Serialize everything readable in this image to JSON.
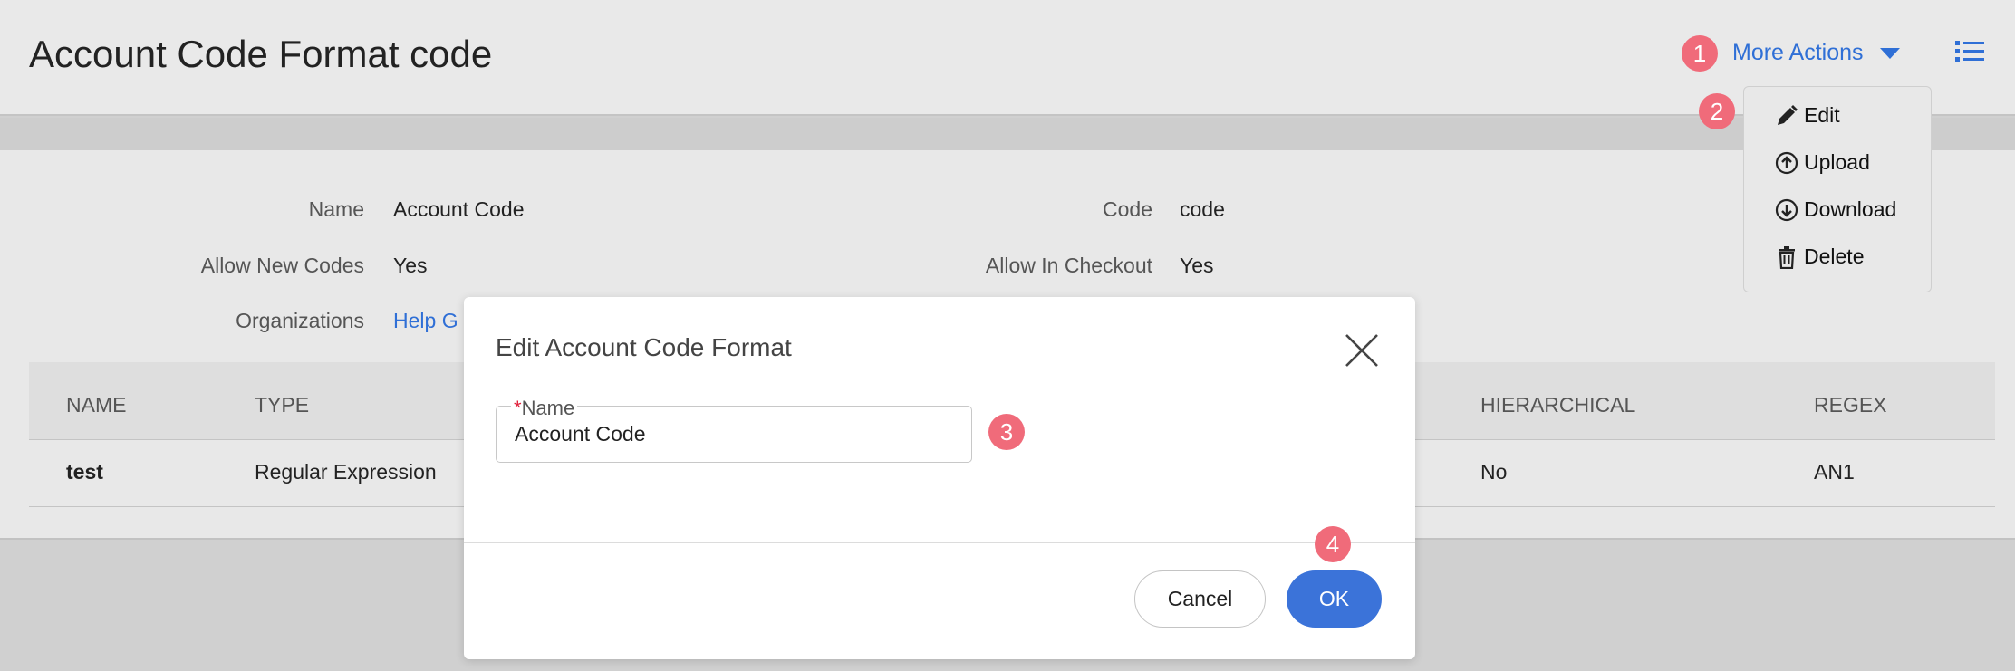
{
  "header": {
    "title": "Account Code Format code",
    "more_actions_label": "More Actions"
  },
  "menu": {
    "items": [
      {
        "label": "Edit",
        "icon": "pencil-icon"
      },
      {
        "label": "Upload",
        "icon": "upload-circle-icon"
      },
      {
        "label": "Download",
        "icon": "download-circle-icon"
      },
      {
        "label": "Delete",
        "icon": "trash-icon"
      }
    ]
  },
  "details": {
    "name_label": "Name",
    "name_value": "Account Code",
    "allow_new_label": "Allow New Codes",
    "allow_new_value": "Yes",
    "organizations_label": "Organizations",
    "organizations_value": "Help G",
    "code_label": "Code",
    "code_value": "code",
    "checkout_label": "Allow In Checkout",
    "checkout_value": "Yes"
  },
  "table": {
    "headers": [
      "NAME",
      "TYPE",
      "HIERARCHICAL",
      "REGEX"
    ],
    "rows": [
      {
        "name": "test",
        "type": "Regular Expression",
        "hierarchical": "No",
        "regex": "AN1"
      }
    ]
  },
  "modal": {
    "title": "Edit Account Code Format",
    "field_required_mark": "*",
    "field_label": "Name",
    "field_value": "Account Code",
    "cancel_label": "Cancel",
    "ok_label": "OK"
  },
  "markers": [
    "1",
    "2",
    "3",
    "4"
  ],
  "colors": {
    "accent": "#3b73d9",
    "link": "#2f6fd6",
    "marker": "#f06b7a",
    "required": "#e0203a"
  }
}
